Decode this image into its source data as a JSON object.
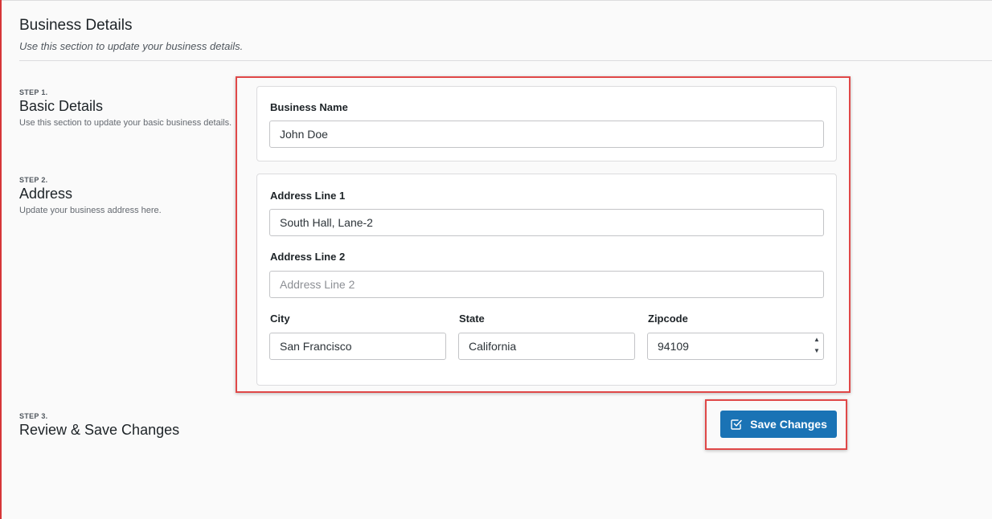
{
  "header": {
    "title": "Business Details",
    "subtitle": "Use this section to update your business details."
  },
  "steps": [
    {
      "label": "STEP 1.",
      "title": "Basic Details",
      "description": "Use this section to update your basic business details."
    },
    {
      "label": "STEP 2.",
      "title": "Address",
      "description": "Update your business address here."
    },
    {
      "label": "STEP 3.",
      "title": "Review & Save Changes",
      "description": ""
    }
  ],
  "form": {
    "business_name": {
      "label": "Business Name",
      "value": "John Doe",
      "placeholder": ""
    },
    "address_line_1": {
      "label": "Address Line 1",
      "value": "South Hall, Lane-2",
      "placeholder": ""
    },
    "address_line_2": {
      "label": "Address Line 2",
      "value": "",
      "placeholder": "Address Line 2"
    },
    "city": {
      "label": "City",
      "value": "San Francisco"
    },
    "state": {
      "label": "State",
      "value": "California"
    },
    "zipcode": {
      "label": "Zipcode",
      "value": "94109"
    }
  },
  "actions": {
    "save_label": "Save Changes",
    "save_icon": "checkbox-edit-icon",
    "button_color": "#1a73b5"
  },
  "colors": {
    "highlight": "#e04848",
    "accent_bar": "#d63638"
  }
}
